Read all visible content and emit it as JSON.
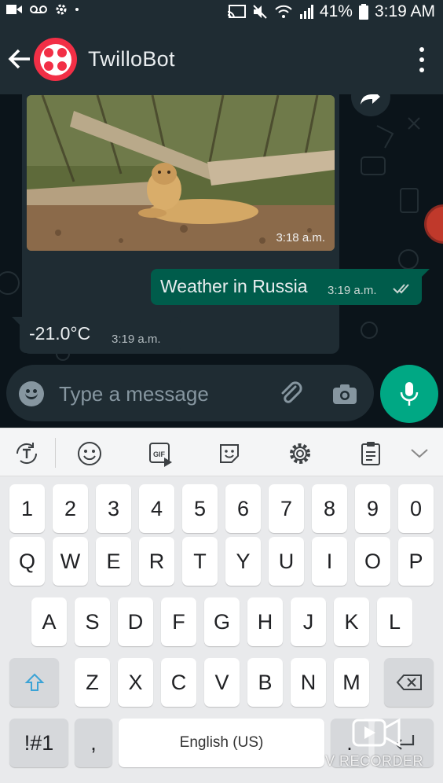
{
  "status_bar": {
    "battery_text": "41%",
    "time": "3:19 AM",
    "icons": [
      "video-icon",
      "voicemail-icon",
      "settings-gear-icon",
      "cast-icon",
      "mute-icon",
      "wifi-icon",
      "signal-icon",
      "battery-icon"
    ]
  },
  "header": {
    "title": "TwilloBot",
    "avatar_color": "#f22f46",
    "bar_color": "#1f2c33"
  },
  "messages": [
    {
      "direction": "incoming",
      "type": "image",
      "time": "3:18 a.m."
    },
    {
      "direction": "outgoing",
      "type": "text",
      "text": "Weather in Russia",
      "time": "3:19 a.m.",
      "status": "read"
    },
    {
      "direction": "incoming",
      "type": "text",
      "text": "-21.0°C",
      "time": "3:19 a.m."
    }
  ],
  "composer": {
    "placeholder": "Type a message",
    "accent_color": "#00a884"
  },
  "keyboard": {
    "toolbar_icons": [
      "text-translate-icon",
      "emoji-icon",
      "gif-icon",
      "sticker-icon",
      "settings-icon",
      "clipboard-icon",
      "collapse-chevron-icon"
    ],
    "row_numbers": [
      "1",
      "2",
      "3",
      "4",
      "5",
      "6",
      "7",
      "8",
      "9",
      "0"
    ],
    "row1": [
      "Q",
      "W",
      "E",
      "R",
      "T",
      "Y",
      "U",
      "I",
      "O",
      "P"
    ],
    "row2": [
      "A",
      "S",
      "D",
      "F",
      "G",
      "H",
      "J",
      "K",
      "L"
    ],
    "row3": [
      "Z",
      "X",
      "C",
      "V",
      "B",
      "N",
      "M"
    ],
    "symbols_key": "!#1",
    "comma_key": ",",
    "space_key": "English (US)",
    "period_key": "."
  },
  "watermark": {
    "text": "V RECORDER"
  }
}
